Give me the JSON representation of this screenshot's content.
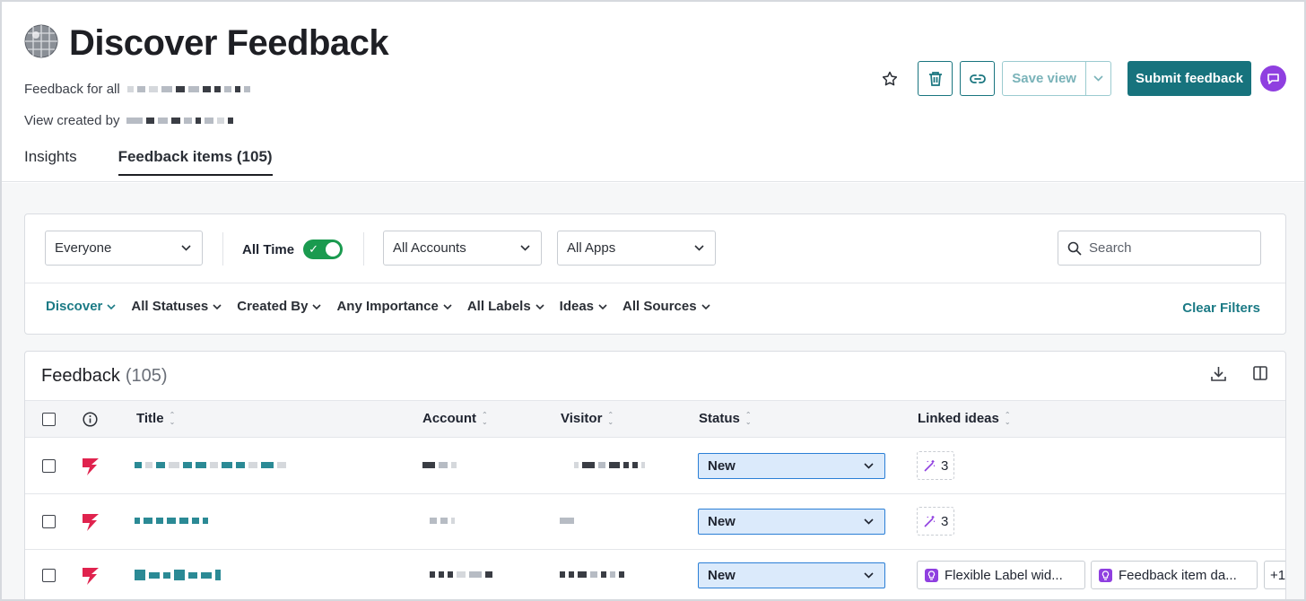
{
  "header": {
    "title": "Discover Feedback",
    "feedback_for_label": "Feedback for all",
    "created_by_label": "View created by",
    "tabs": [
      {
        "label": "Insights"
      },
      {
        "label": "Feedback items  (105)"
      }
    ]
  },
  "actions": {
    "save_view_label": "Save view",
    "submit_label": "Submit feedback"
  },
  "filters": {
    "audience": "Everyone",
    "all_time_label": "All Time",
    "all_time_on": true,
    "accounts": "All Accounts",
    "apps": "All Apps",
    "search_placeholder": "Search",
    "dropdowns": [
      "Discover",
      "All Statuses",
      "Created By",
      "Any Importance",
      "All Labels",
      "Ideas",
      "All Sources"
    ],
    "clear_label": "Clear Filters"
  },
  "table": {
    "title": "Feedback",
    "count": "(105)",
    "columns": [
      "Title",
      "Account",
      "Visitor",
      "Status",
      "Linked ideas"
    ],
    "rows": [
      {
        "status": "New",
        "linked_ideas_count": "3"
      },
      {
        "status": "New",
        "linked_ideas_count": "3"
      },
      {
        "status": "New",
        "idea_chips": [
          "Flexible Label wid...",
          "Feedback item da..."
        ],
        "more": "+1"
      }
    ]
  },
  "colors": {
    "accent": "#17737d",
    "flag": "#e0234e",
    "toggle_on": "#1a9a4f",
    "idea_purple": "#8f3fe0",
    "status_bg": "#dbeafb"
  }
}
